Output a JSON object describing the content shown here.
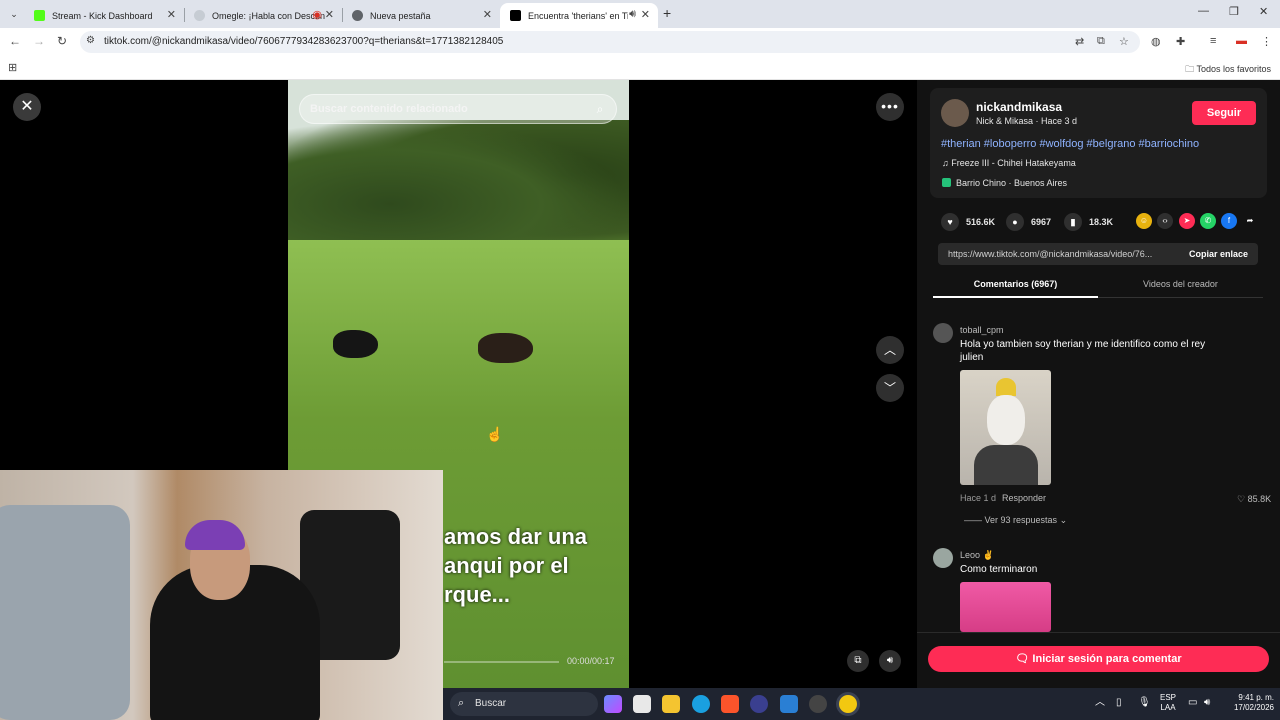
{
  "browser": {
    "tabs": [
      {
        "title": "Stream - Kick Dashboard",
        "color": "#53fc18"
      },
      {
        "title": "Omegle: ¡Habla con Descon",
        "color": "#9aa0a6"
      },
      {
        "title": "Nueva pestaña",
        "color": "#5f6368"
      },
      {
        "title": "Encuentra 'therians' en TikT",
        "color": "#000000"
      }
    ],
    "url": "tiktok.com/@nickandmikasa/video/7606777934283623700?q=therians&t=1771382128405",
    "bookmarks_folder": "Todos los favoritos"
  },
  "video": {
    "search_placeholder": "Buscar contenido relacionado",
    "caption_lines": [
      "amos dar una",
      "anqui por el",
      "rque..."
    ],
    "timecode": "00:00/00:17"
  },
  "post": {
    "username": "nickandmikasa",
    "subtitle": "Nick & Mikasa · Hace 3 d",
    "follow_label": "Seguir",
    "hashtags": "#therian #loboperro #wolfdog #belgrano #barriochino",
    "music": "Freeze III - Chihei Hatakeyama",
    "location": "Barrio Chino · Buenos Aires",
    "likes": "516.6K",
    "comments": "6967",
    "saves": "18.3K",
    "link": "https://www.tiktok.com/@nickandmikasa/video/76...",
    "copy_label": "Copiar enlace"
  },
  "tabs": {
    "comments": "Comentarios (6967)",
    "creator": "Videos del creador"
  },
  "comments": [
    {
      "user": "toball_cpm",
      "text": "Hola yo tambien soy therian y me identifico como el rey julien",
      "time": "Hace 1 d",
      "reply": "Responder",
      "likes": "85.8K",
      "replies": "Ver 93 respuestas"
    },
    {
      "user": "Leoo ✌",
      "text": "Como terminaron"
    }
  ],
  "login_label": "Iniciar sesión para comentar",
  "taskbar": {
    "search": "Buscar",
    "lang": "ESP",
    "lang2": "LAA",
    "time": "9:41 p. m.",
    "date": "17/02/2026"
  }
}
